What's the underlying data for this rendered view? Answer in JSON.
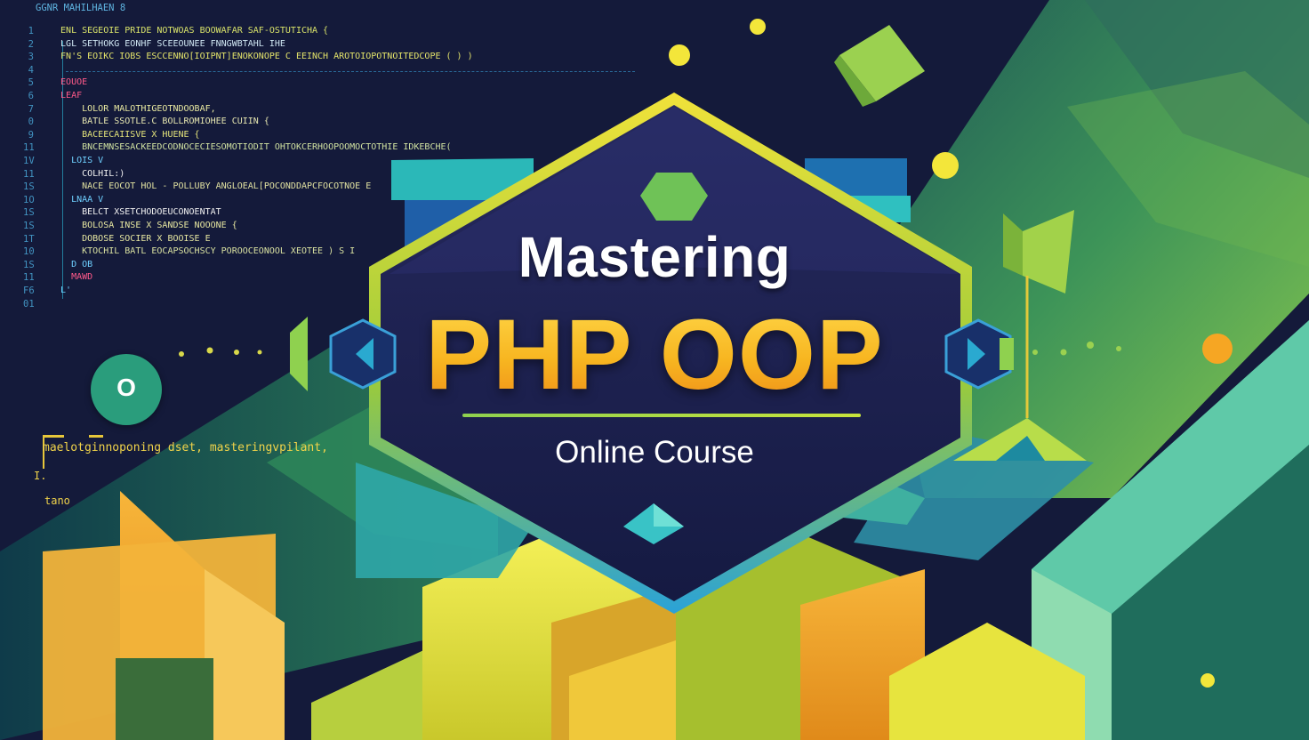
{
  "title": {
    "line1": "Mastering",
    "line2": "PHP OOP",
    "subtitle": "Online Course"
  },
  "badge": {
    "letter": "O"
  },
  "code_editor": {
    "header": "GGNR MAHILHAEN 8",
    "line_numbers": [
      "1",
      "2",
      "3",
      "4",
      "5",
      "6",
      "7",
      "0",
      "9",
      "11",
      "1V",
      "11",
      "1S",
      "1O",
      "1S",
      "1S",
      "1T",
      "10",
      "1S",
      "11",
      "F6",
      "01"
    ],
    "lines": [
      "  ENL SEGEOIE PRIDE NOTWOAS BOOWAFAR SAF-OSTUTICHA {",
      "  LGL SETHOKG EONHF SCEEOUNEE FNNGWBTAHL IHE",
      "  FN'S EOIKC IOBS ESCCENNO[IOIPNT]ENOKONOPE C EEINCH AROTOIOPOTNOITEDCOPE ( ) )",
      "",
      "  EOUOE",
      "  LEAF",
      "      LOLOR MALOTHIGEOTNDOOBAF,",
      "      BATLE SSOTLE.C BOLLROMIOHEE CUIIN {",
      "      BACEECAIISVE X HUENE {",
      "      BNCEMNSESACKEEDCODNOCECIESOMOTIODIT OHTOKCERHOOPOOMOCTOTHIE IDKEBCHE(",
      "    LOIS V",
      "      COLHIL:)",
      "      NACE EOCOT HOL - POLLUBY ANGLOEAL[POCONDDAPCFOCOTNOE E",
      "    LNAA V",
      "      BELCT XSETCHODOEUCONOENTAT",
      "      BOLOSA INSE X SANDSE NOOONE {",
      "      DOBOSE SOCIER X BOOISE E",
      "      KTOCHIL BATL EOCAPSOCHSCY POROOCEONOOL XEOTEE ) S I",
      "    D OB",
      "    MAWD",
      "  L'",
      ""
    ],
    "snippet": "maelotginnoponing dset, masteringvpilant,",
    "snippet_small": "tano",
    "snippet_dot": "I."
  },
  "colors": {
    "background": "#141a3a",
    "title_white": "#ffffff",
    "title_gold": "#f6b51e",
    "accent_green": "#8fd14f",
    "accent_teal": "#2fc6c6",
    "accent_yellow": "#f3e63a",
    "accent_orange": "#f6a623",
    "badge_green": "#2a9d7c"
  },
  "icons": [
    "o-badge",
    "gem-hexagon-icon",
    "diamond-icon",
    "arrow-left-icon",
    "arrow-right-icon"
  ]
}
